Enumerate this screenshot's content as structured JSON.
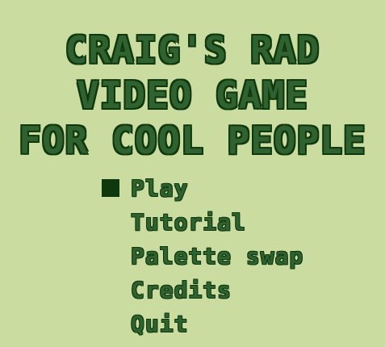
{
  "title": {
    "line1": "CRAIG'S RAD",
    "line2": "VIDEO GAME",
    "line3": "FOR COOL PEOPLE"
  },
  "menu": {
    "selected_index": 0,
    "items": [
      {
        "label": "Play"
      },
      {
        "label": "Tutorial"
      },
      {
        "label": "Palette swap"
      },
      {
        "label": "Credits"
      },
      {
        "label": "Quit"
      }
    ]
  },
  "colors": {
    "background": "#cadc9f",
    "text": "#306230",
    "outline": "#0f380f",
    "cursor": "#0f380f"
  }
}
